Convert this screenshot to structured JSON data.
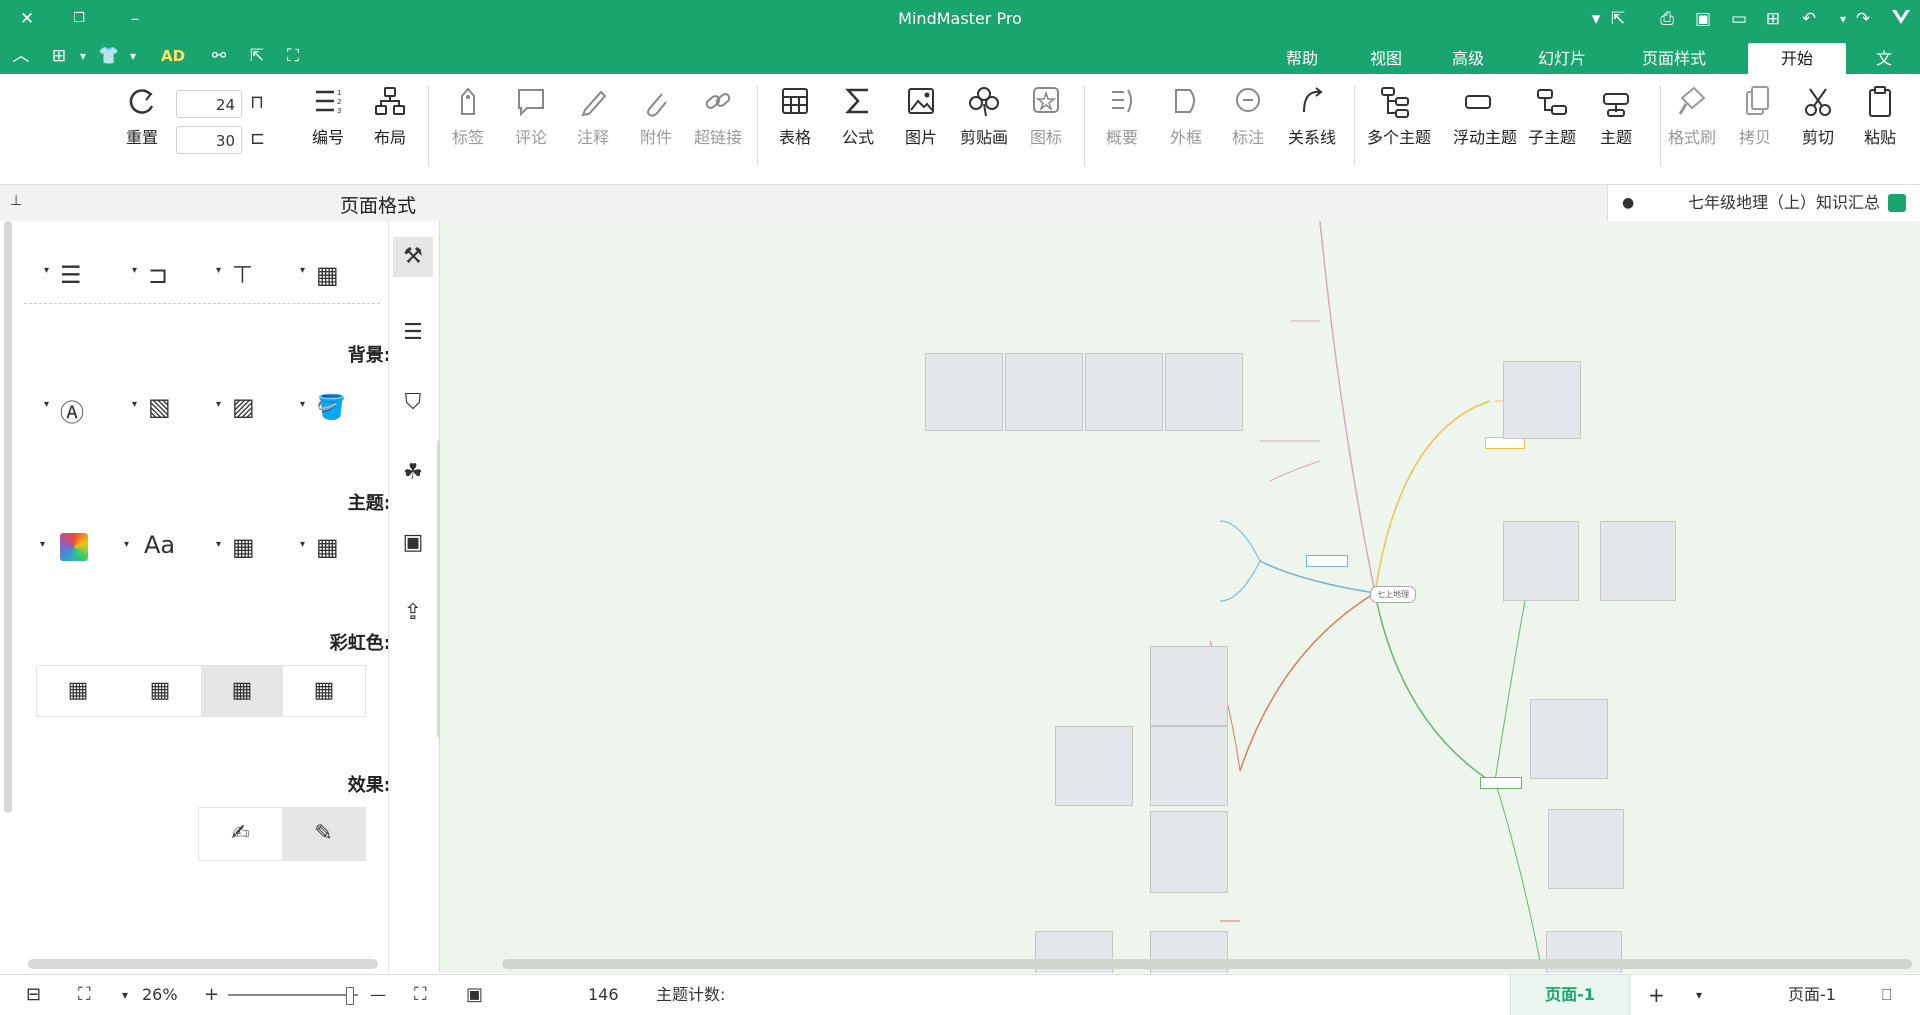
{
  "window": {
    "title": "MindMaster Pro"
  },
  "menu": {
    "tabs": [
      "文件",
      "开始",
      "页面样式",
      "幻灯片",
      "高级",
      "视图",
      "帮助"
    ],
    "active": "开始"
  },
  "quick_access": {
    "ad_label": "AD"
  },
  "ribbon": {
    "paste": "粘贴",
    "cut": "剪切",
    "copy": "拷贝",
    "format_painter": "格式刷",
    "topic": "主题",
    "subtopic": "子主题",
    "floating_topic": "浮动主题",
    "multiple_topics": "多个主题",
    "relationship": "关系线",
    "callout": "标注",
    "boundary": "外框",
    "summary": "概要",
    "icon": "图标",
    "clipart": "剪贴画",
    "picture": "图片",
    "formula": "公式",
    "table": "表格",
    "hyperlink": "超链接",
    "attachment": "附件",
    "note": "注释",
    "comment": "评论",
    "tag": "标签",
    "layout": "布局",
    "numbering": "编号",
    "reset": "重置",
    "spin_top": "24",
    "spin_bottom": "30"
  },
  "document": {
    "tab_title": "七年级地理（上）知识汇总"
  },
  "side_panel": {
    "title": "页面格式",
    "background_label": "背景:",
    "theme_label": "主题:",
    "rainbow_label": "彩虹色:",
    "effect_label": "效果:",
    "theme_font_label": "Aa"
  },
  "canvas": {
    "central_topic": "七上地理"
  },
  "status": {
    "page_nav": "页面-1",
    "active_page": "页面-1",
    "topic_count_label": "主题计数:",
    "topic_count": "146",
    "zoom": "26%"
  },
  "colors": {
    "brand": "#1aa56e",
    "canvas_bg": "#edf5ed"
  }
}
